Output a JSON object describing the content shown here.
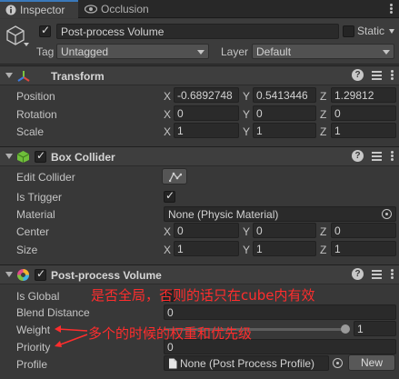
{
  "tabs": [
    {
      "label": "Inspector",
      "icon": "info-icon"
    },
    {
      "label": "Occlusion",
      "icon": "eye-icon"
    }
  ],
  "header": {
    "object_name": "Post-process Volume",
    "static_label": "Static",
    "tag_label": "Tag",
    "tag_value": "Untagged",
    "layer_label": "Layer",
    "layer_value": "Default"
  },
  "transform": {
    "title": "Transform",
    "rows": [
      {
        "label": "Position",
        "x": "-0.6892748",
        "y": "0.5413446",
        "z": "1.29812"
      },
      {
        "label": "Rotation",
        "x": "0",
        "y": "0",
        "z": "0"
      },
      {
        "label": "Scale",
        "x": "1",
        "y": "1",
        "z": "1"
      }
    ]
  },
  "box_collider": {
    "title": "Box Collider",
    "edit_collider_label": "Edit Collider",
    "is_trigger_label": "Is Trigger",
    "material_label": "Material",
    "material_value": "None (Physic Material)",
    "center_label": "Center",
    "center": {
      "x": "0",
      "y": "0",
      "z": "0"
    },
    "size_label": "Size",
    "size": {
      "x": "1",
      "y": "1",
      "z": "1"
    }
  },
  "axis_letters": {
    "x": "X",
    "y": "Y",
    "z": "Z"
  },
  "post_process": {
    "title": "Post-process Volume",
    "is_global_label": "Is Global",
    "blend_distance_label": "Blend Distance",
    "blend_distance_value": "0",
    "weight_label": "Weight",
    "weight_value": "1",
    "priority_label": "Priority",
    "priority_value": "0",
    "profile_label": "Profile",
    "profile_value": "None (Post Process Profile)",
    "new_button": "New"
  },
  "annotations": {
    "is_global_note": "是否全局，否则的话只在cube内有效",
    "weight_note": "多个的时候的权重和优先级"
  },
  "colors": {
    "annotation": "#ff2d2d",
    "tab_accent": "#3a79bb",
    "background": "#383838"
  }
}
